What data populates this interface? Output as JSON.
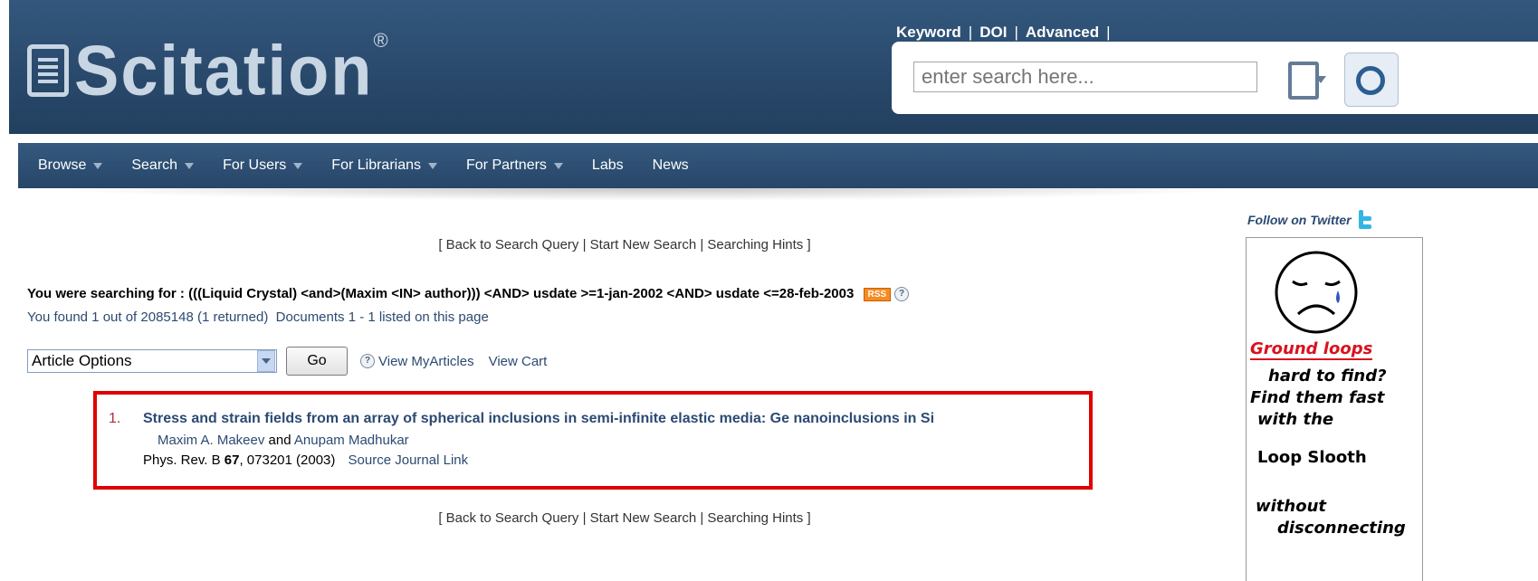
{
  "header": {
    "logo_text": "Scitation",
    "logo_mark": "®",
    "search_modes": [
      "Keyword",
      "DOI",
      "Advanced"
    ],
    "search_placeholder": "enter search here...",
    "search_icon": "magnifier-icon",
    "doc_icon": "document-dropdown-icon"
  },
  "nav": {
    "items": [
      {
        "label": "Browse",
        "dropdown": true
      },
      {
        "label": "Search",
        "dropdown": true
      },
      {
        "label": "For Users",
        "dropdown": true
      },
      {
        "label": "For Librarians",
        "dropdown": true
      },
      {
        "label": "For Partners",
        "dropdown": true
      },
      {
        "label": "Labs",
        "dropdown": false
      },
      {
        "label": "News",
        "dropdown": false
      }
    ]
  },
  "hints": {
    "open": "[ ",
    "back": "Back to Search Query",
    "sep": " | ",
    "new_search": "Start New Search",
    "hints": "Searching Hints",
    "close": " ]"
  },
  "query": {
    "lead": "You were searching for :",
    "text": " (((Liquid Crystal) <and>(Maxim <IN> author))) <AND> usdate >=1-jan-2002 <AND> usdate <=28-feb-2003",
    "rss": "RSS",
    "help": "?"
  },
  "found": {
    "text": "You found 1 out of 2085148 (1 returned)",
    "docs": "Documents 1 - 1 listed on this page"
  },
  "options": {
    "select_value": "Article Options",
    "go": "Go",
    "help": "?",
    "my_articles": "View MyArticles",
    "cart": "View Cart"
  },
  "results": [
    {
      "num": "1.",
      "title": "Stress and strain fields from an array of spherical inclusions in semi-infinite elastic media: Ge nanoinclusions in Si",
      "author1": "Maxim A. Makeev",
      "and": "and",
      "author2": "Anupam Madhukar",
      "journal": "Phys. Rev. B",
      "volume": "67",
      "cite_rest": ", 073201 (2003)",
      "source_link": "Source Journal Link"
    }
  ],
  "sidebar": {
    "twitter": "Follow on Twitter",
    "ad": {
      "line1": "Ground loops",
      "line2": "hard to find?",
      "line3": "Find them fast",
      "line4": "with the",
      "line5": "Loop Slooth",
      "line6": "without",
      "line7": "disconnecting"
    }
  },
  "colors": {
    "header_bg": "#2b4b6f",
    "nav_bg": "#2f5078",
    "link": "#2b4a73",
    "highlight_box": "#e00000",
    "rss": "#f68b1f"
  }
}
